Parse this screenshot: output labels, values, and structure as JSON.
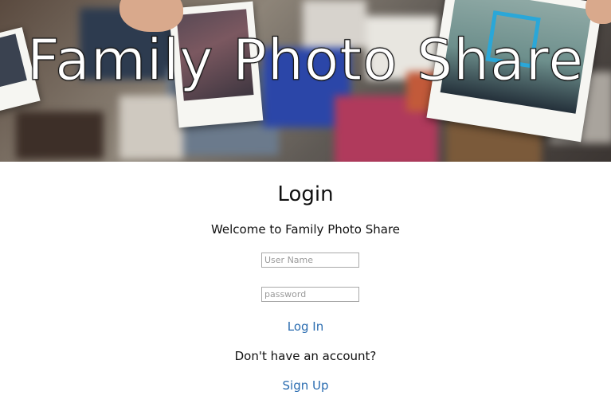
{
  "hero": {
    "title": "Family Photo Share"
  },
  "login": {
    "heading": "Login",
    "welcome": "Welcome to Family Photo Share",
    "username_placeholder": "User Name",
    "password_placeholder": "password",
    "login_link": "Log In",
    "no_account_text": "Don't have an account?",
    "signup_link": "Sign Up"
  },
  "colors": {
    "link": "#2a6cb0",
    "text": "#111111",
    "background": "#ffffff"
  }
}
